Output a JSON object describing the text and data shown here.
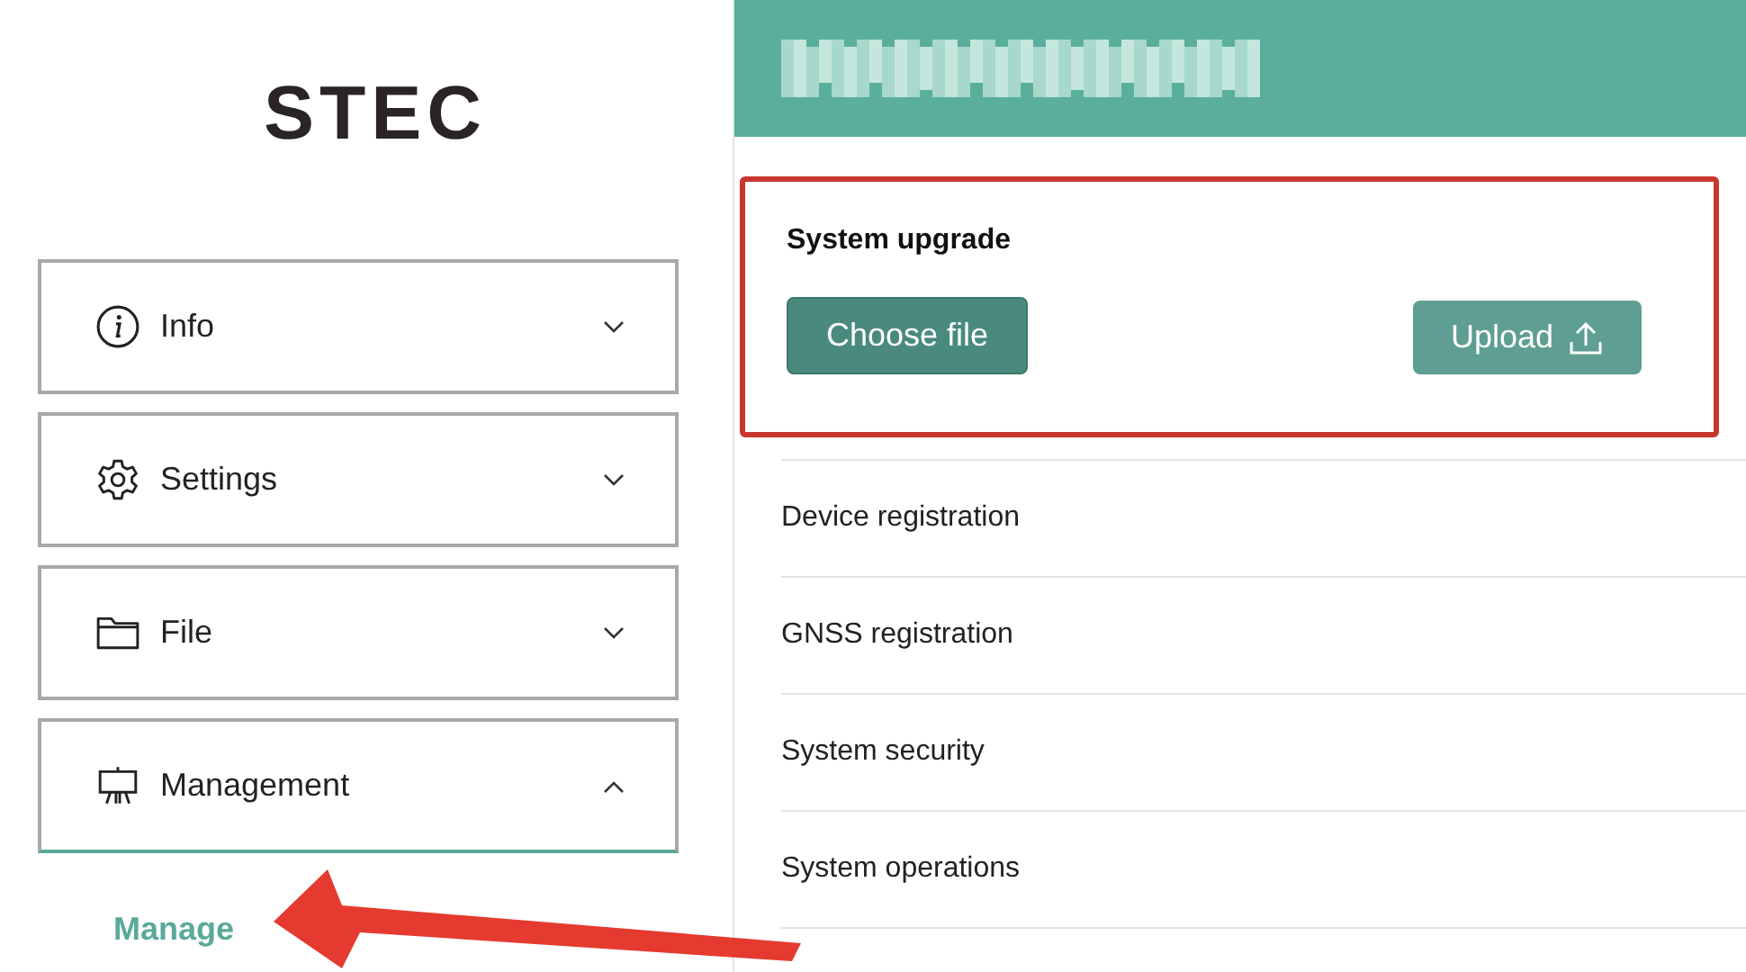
{
  "logo": {
    "text": "STEC"
  },
  "menu": [
    {
      "label": "Info",
      "expanded": false
    },
    {
      "label": "Settings",
      "expanded": false
    },
    {
      "label": "File",
      "expanded": false
    },
    {
      "label": "Management",
      "expanded": true,
      "children": [
        {
          "label": "Manage",
          "selected": true
        }
      ]
    }
  ],
  "upgrade": {
    "title": "System upgrade",
    "choose_button": "Choose file",
    "upload_button": "Upload",
    "highlighted": true
  },
  "sections": [
    {
      "label": "Device registration"
    },
    {
      "label": "GNSS registration"
    },
    {
      "label": "System security"
    },
    {
      "label": "System operations"
    }
  ],
  "annotation": {
    "kind": "arrow"
  }
}
